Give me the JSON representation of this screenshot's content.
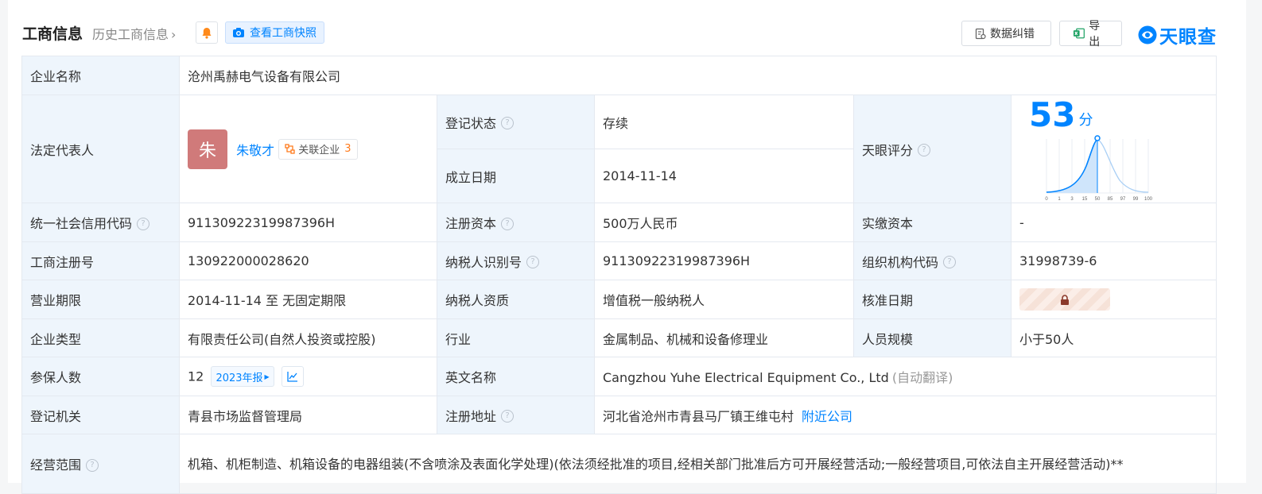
{
  "header": {
    "title": "工商信息",
    "history_link": "历史工商信息",
    "snapshot_button": "查看工商快照",
    "fix_button": "数据纠错",
    "export_button": "导出",
    "brand": "天眼查"
  },
  "colors": {
    "accent": "#0084ff",
    "label_bg": "#eef5fc",
    "status_green": "#21a05c",
    "avatar": "#d07a7a",
    "count_orange": "#ff7a1b"
  },
  "company": {
    "name_label": "企业名称",
    "name": "沧州禹赫电气设备有限公司",
    "legal_rep_label": "法定代表人",
    "legal_rep_avatar_char": "朱",
    "legal_rep_name": "朱敬才",
    "related_label": "关联企业",
    "related_count": "3",
    "reg_status_label": "登记状态",
    "reg_status": "存续",
    "founded_label": "成立日期",
    "founded": "2014-11-14",
    "score_label": "天眼评分",
    "score": "53",
    "score_unit": "分",
    "score_axis": [
      "0",
      "1",
      "3",
      "15",
      "50",
      "85",
      "97",
      "99",
      "100"
    ],
    "credit_code_label": "统一社会信用代码",
    "credit_code": "91130922319987396H",
    "reg_capital_label": "注册资本",
    "reg_capital": "500万人民币",
    "paid_capital_label": "实缴资本",
    "paid_capital": "-",
    "biz_reg_no_label": "工商注册号",
    "biz_reg_no": "130922000028620",
    "taxpayer_id_label": "纳税人识别号",
    "taxpayer_id": "91130922319987396H",
    "org_code_label": "组织机构代码",
    "org_code": "31998739-6",
    "term_label": "营业期限",
    "term": "2014-11-14 至 无固定期限",
    "taxpayer_qual_label": "纳税人资质",
    "taxpayer_qual": "增值税一般纳税人",
    "approval_date_label": "核准日期",
    "type_label": "企业类型",
    "type": "有限责任公司(自然人投资或控股)",
    "industry_label": "行业",
    "industry": "金属制品、机械和设备修理业",
    "staff_size_label": "人员规模",
    "staff_size": "小于50人",
    "insured_label": "参保人数",
    "insured": "12",
    "insured_year_tag": "2023年报",
    "english_name_label": "英文名称",
    "english_name": "Cangzhou Yuhe Electrical Equipment Co., Ltd",
    "english_name_note": "(自动翻译)",
    "authority_label": "登记机关",
    "authority": "青县市场监督管理局",
    "address_label": "注册地址",
    "address": "河北省沧州市青县马厂镇王维屯村",
    "nearby_link": "附近公司",
    "scope_label": "经营范围",
    "scope": "机箱、机柜制造、机箱设备的电器组装(不含喷涂及表面化学处理)(依法须经批准的项目,经相关部门批准后方可开展经营活动;一般经营项目,可依法自主开展经营活动)**"
  }
}
